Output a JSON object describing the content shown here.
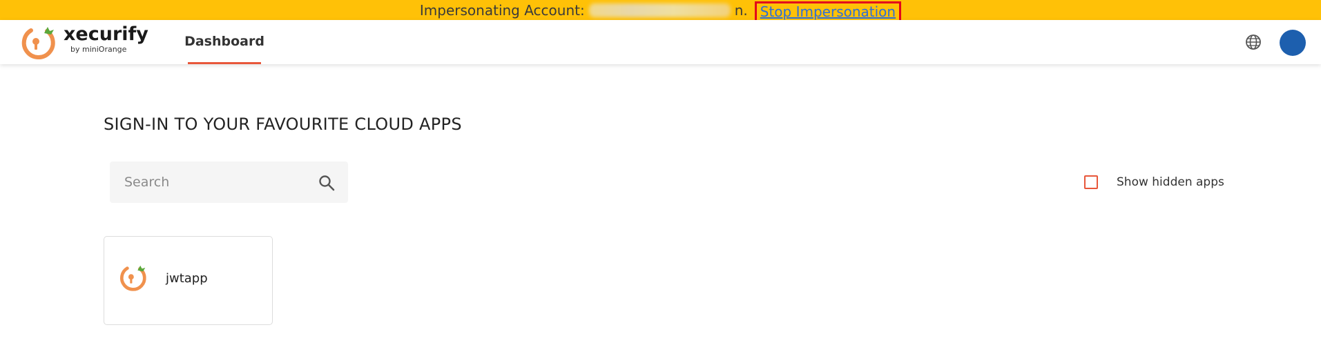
{
  "banner": {
    "prefix": "Impersonating Account:",
    "account_suffix": "n.",
    "stop_link": "Stop Impersonation"
  },
  "brand": {
    "name": "xecurify",
    "byline": "by miniOrange"
  },
  "nav": {
    "tabs": [
      {
        "label": "Dashboard",
        "active": true
      }
    ]
  },
  "header": {
    "language_icon": "globe-icon",
    "avatar": "user-avatar"
  },
  "main": {
    "title": "SIGN-IN TO YOUR FAVOURITE CLOUD APPS",
    "search": {
      "placeholder": "Search",
      "value": ""
    },
    "show_hidden": {
      "label": "Show hidden apps",
      "checked": false
    },
    "apps": [
      {
        "name": "jwtapp",
        "icon": "xecurify-logo-icon"
      }
    ]
  },
  "colors": {
    "banner_bg": "#ffc107",
    "accent": "#e8563a",
    "highlight_box": "#e3001b",
    "link": "#2e6fd6",
    "avatar_bg": "#1d5fae"
  }
}
